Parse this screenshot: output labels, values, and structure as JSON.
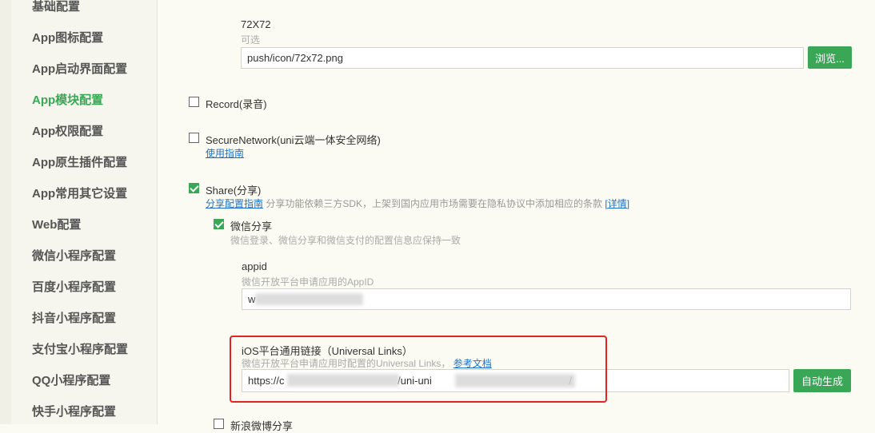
{
  "sidebar": {
    "items": [
      {
        "label": "基础配置",
        "active": false
      },
      {
        "label": "App图标配置",
        "active": false
      },
      {
        "label": "App启动界面配置",
        "active": false
      },
      {
        "label": "App模块配置",
        "active": true
      },
      {
        "label": "App权限配置",
        "active": false
      },
      {
        "label": "App原生插件配置",
        "active": false
      },
      {
        "label": "App常用其它设置",
        "active": false
      },
      {
        "label": "Web配置",
        "active": false
      },
      {
        "label": "微信小程序配置",
        "active": false
      },
      {
        "label": "百度小程序配置",
        "active": false
      },
      {
        "label": "抖音小程序配置",
        "active": false
      },
      {
        "label": "支付宝小程序配置",
        "active": false
      },
      {
        "label": "QQ小程序配置",
        "active": false
      },
      {
        "label": "快手小程序配置",
        "active": false
      }
    ]
  },
  "icon72": {
    "title": "72X72",
    "hint": "可选",
    "value": "push/icon/72x72.png",
    "browse_label": "浏览..."
  },
  "record": {
    "label": "Record(录音)",
    "checked": false
  },
  "secure_network": {
    "label": "SecureNetwork(uni云端一体安全网络)",
    "link": "使用指南",
    "checked": false
  },
  "share": {
    "label": "Share(分享)",
    "checked": true,
    "link": "分享配置指南",
    "note": "分享功能依赖三方SDK，上架到国内应用市场需要在隐私协议中添加相应的条款",
    "detail_link": "[详情]",
    "wechat": {
      "label": "微信分享",
      "checked": true,
      "hint": "微信登录、微信分享和微信支付的配置信息应保持一致",
      "appid_title": "appid",
      "appid_hint": "微信开放平台申请应用的AppID",
      "appid_value": "w",
      "ul_title": "iOS平台通用链接（Universal Links）",
      "ul_hint": "微信开放平台申请应用时配置的Universal Links，",
      "ul_link": "参考文档",
      "ul_value": "https://c",
      "ul_value_tail": "/uni-uni",
      "ul_value_end": "/",
      "auto_label": "自动生成"
    },
    "weibo": {
      "label": "新浪微博分享",
      "checked": false
    }
  },
  "colors": {
    "accent": "#3aa757",
    "highlight": "#e02424",
    "link": "#1a73c9"
  }
}
